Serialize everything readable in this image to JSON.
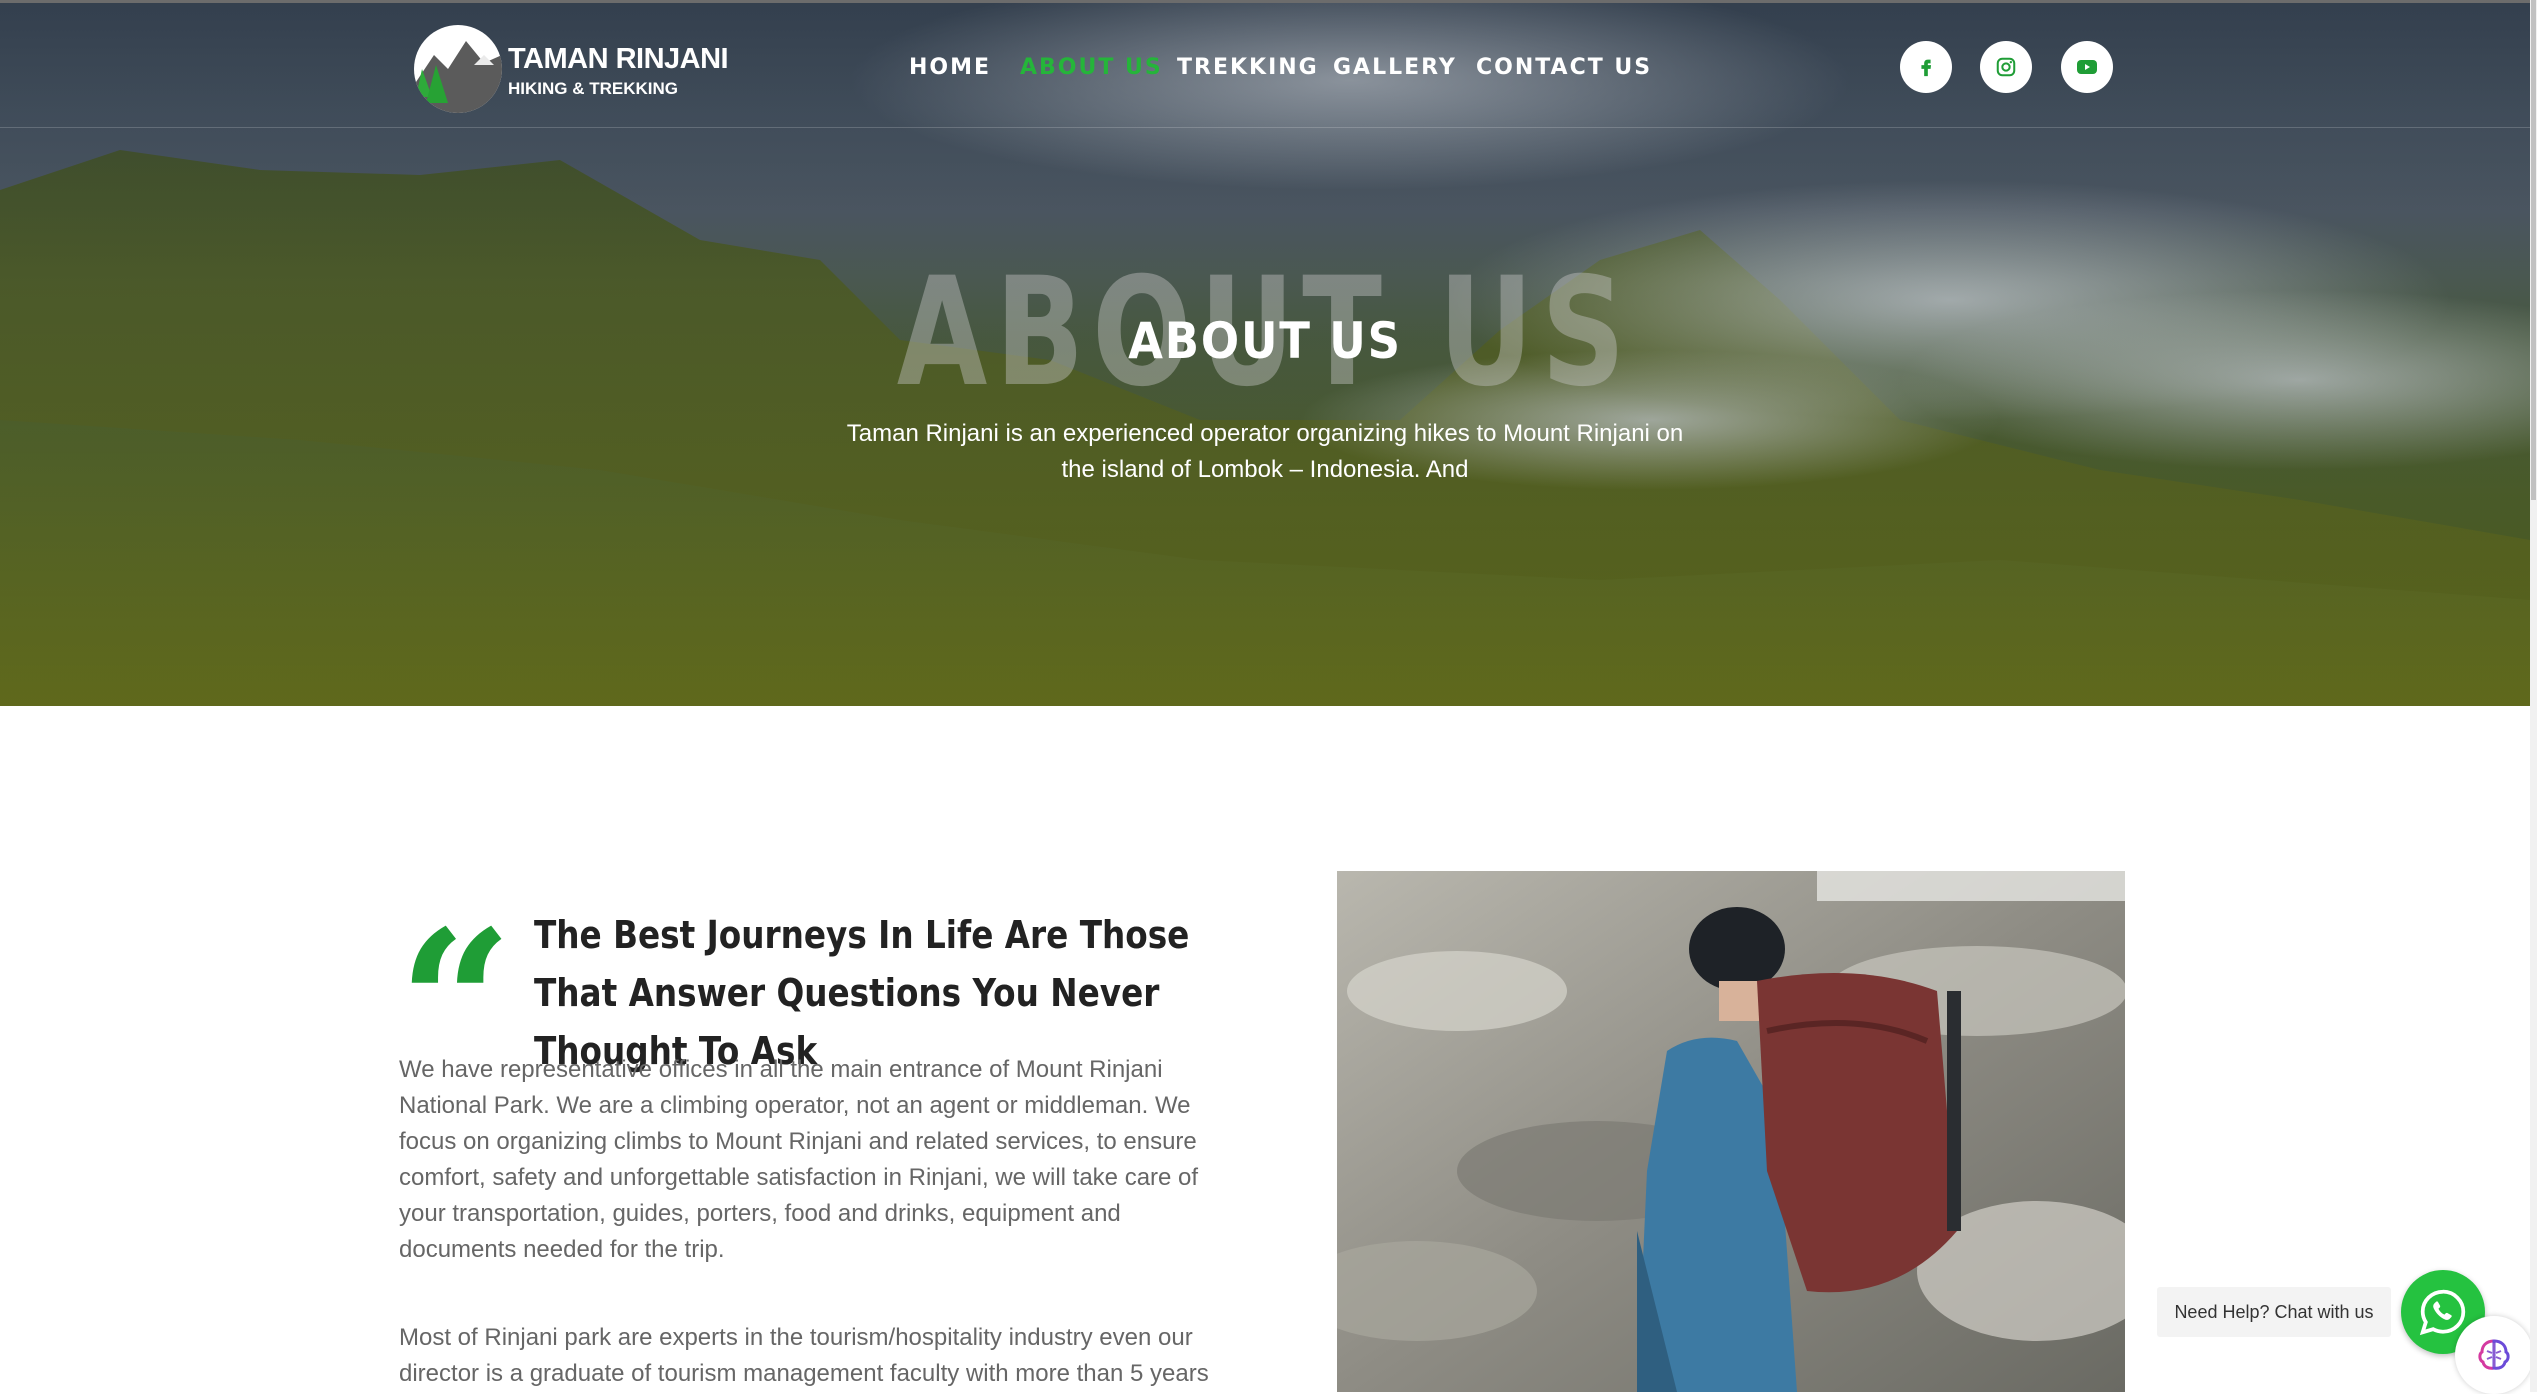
{
  "brand": {
    "name": "TAMAN RINJANI",
    "tagline": "HIKING & TREKKING"
  },
  "nav": {
    "items": [
      {
        "label": "HOME",
        "active": false
      },
      {
        "label": "ABOUT US",
        "active": true
      },
      {
        "label": "TREKKING",
        "active": false
      },
      {
        "label": "GALLERY",
        "active": false
      },
      {
        "label": "CONTACT US",
        "active": false
      }
    ]
  },
  "social": [
    {
      "icon": "facebook-icon"
    },
    {
      "icon": "instagram-icon"
    },
    {
      "icon": "youtube-icon"
    }
  ],
  "hero": {
    "ghost_text": "ABOUT US",
    "title": "ABOUT US",
    "description": "Taman Rinjani is an experienced operator organizing hikes to Mount Rinjani on the island of Lombok – Indonesia. And"
  },
  "content": {
    "headline": "The Best Journeys In Life Are Those That Answer Questions You Never Thought To Ask",
    "paragraph_1": "We have representative offices in all the main entrance of Mount Rinjani National Park. We are a climbing operator, not an agent or middleman. We focus on organizing climbs to Mount Rinjani and related services, to ensure comfort, safety and unforgettable satisfaction in Rinjani, we will take care of your transportation, guides, porters, food and drinks, equipment and documents needed for the trip.",
    "paragraph_2": "Most of Rinjani park are experts in the tourism/hospitality industry even our director is a graduate of tourism management faculty with more than 5 years"
  },
  "chat": {
    "label": "Need Help? Chat with us"
  },
  "colors": {
    "accent": "#25b53a",
    "quote": "#1f9d36",
    "whatsapp": "#25c240"
  }
}
